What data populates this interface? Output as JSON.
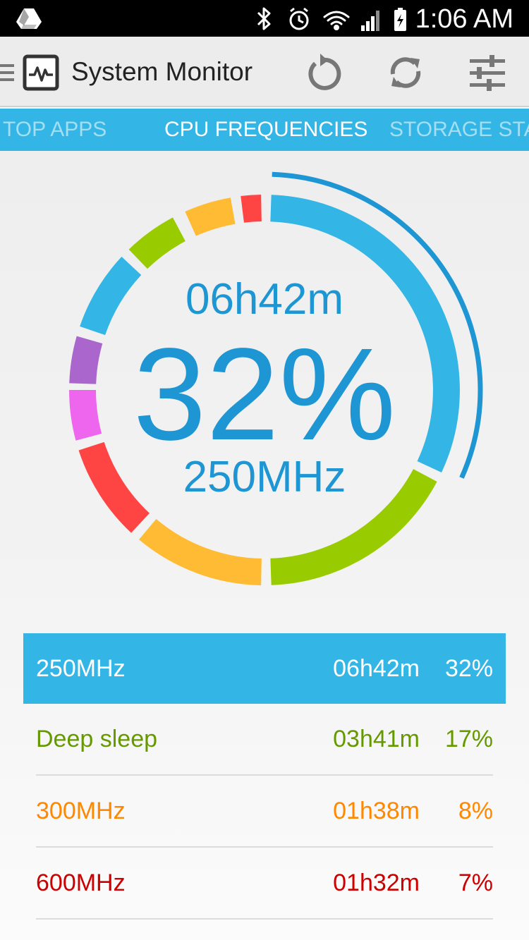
{
  "status_bar": {
    "time": "1:06 AM",
    "icons": [
      "drive-icon",
      "bluetooth-icon",
      "alarm-icon",
      "wifi-icon",
      "signal-icon",
      "battery-icon"
    ]
  },
  "action_bar": {
    "title": "System Monitor",
    "actions": [
      "reset-icon",
      "refresh-icon",
      "settings-sliders-icon"
    ]
  },
  "tabs": [
    {
      "label": "TOP APPS"
    },
    {
      "label": "CPU FREQUENCIES"
    },
    {
      "label": "STORAGE STA"
    }
  ],
  "gauge": {
    "time": "06h42m",
    "percent": "32%",
    "frequency": "250MHz"
  },
  "list": [
    {
      "label": "250MHz",
      "duration": "06h42m",
      "percent": "32%",
      "color": "#ffffff",
      "selected": true
    },
    {
      "label": "Deep sleep",
      "duration": "03h41m",
      "percent": "17%",
      "color": "#669900"
    },
    {
      "label": "300MHz",
      "duration": "01h38m",
      "percent": "8%",
      "color": "#ff8800"
    },
    {
      "label": "600MHz",
      "duration": "01h32m",
      "percent": "7%",
      "color": "#cc0000"
    }
  ],
  "colors": {
    "accent": "#33b5e5",
    "gauge_text": "#1e96d4",
    "ring_segments": [
      "#33b5e5",
      "#99cc00",
      "#ffbb33",
      "#ff4444",
      "#ee66ee",
      "#aa66cc",
      "#33b5e5",
      "#99cc00",
      "#ffbb33",
      "#ff4444",
      "#ee66ee",
      "#aa66cc",
      "#33b5e5",
      "#99cc00"
    ]
  }
}
